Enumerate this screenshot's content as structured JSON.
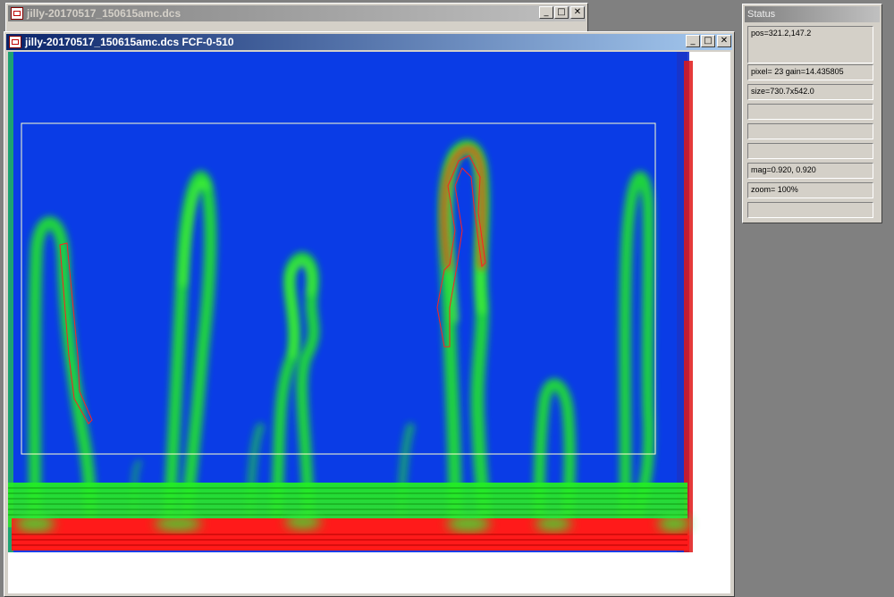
{
  "back_window": {
    "title": "jilly-20170517_150615amc.dcs"
  },
  "main_window": {
    "title": "jilly-20170517_150615amc.dcs FCF-0-510"
  },
  "controls": {
    "minimize": "_",
    "maximize": "□",
    "close": "✕"
  },
  "status_panel": {
    "title": "Status",
    "fields": [
      "pos=321.2,147.2",
      "pixel= 23 gain=14.435805",
      "size=730.7x542.0",
      "",
      "",
      "",
      "mag=0.920, 0.920",
      "zoom= 100%",
      ""
    ]
  },
  "colors": {
    "plot_background": "#0a3ce6",
    "signal_green": "#22ee22",
    "signal_red": "#ff1a1a",
    "selection_outline": "#ffffcc",
    "desktop": "#808080",
    "active_title": "#0a246a"
  },
  "icons": {
    "app": "dcs-app-icon",
    "minimize": "minimize-icon",
    "maximize": "maximize-icon",
    "close": "close-icon"
  }
}
